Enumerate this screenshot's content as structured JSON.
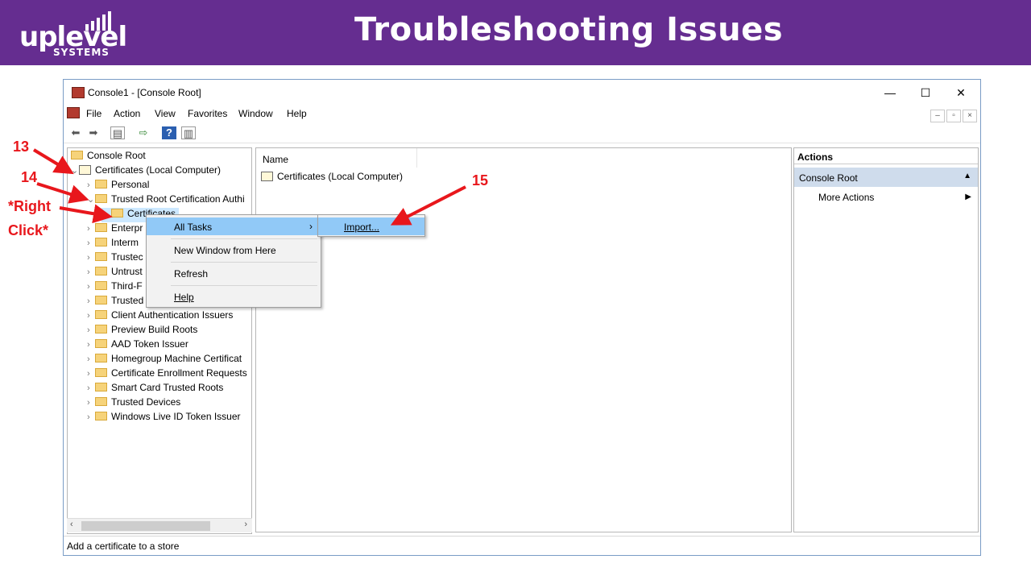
{
  "slide": {
    "logo_text": "uplevel",
    "logo_subtext": "SYSTEMS",
    "title": "Troubleshooting Issues"
  },
  "window": {
    "title": "Console1 - [Console Root]",
    "controls": {
      "minimize": "—",
      "maximize": "☐",
      "close": "✕"
    },
    "menu": [
      "File",
      "Action",
      "View",
      "Favorites",
      "Window",
      "Help"
    ]
  },
  "tree": {
    "items": [
      {
        "label": "Console Root"
      },
      {
        "label": "Certificates (Local Computer)"
      },
      {
        "label": "Personal"
      },
      {
        "label": "Trusted Root Certification Authi"
      },
      {
        "label": "Certificates"
      },
      {
        "label": "Enterpr"
      },
      {
        "label": "Interm"
      },
      {
        "label": "Trustec"
      },
      {
        "label": "Untrust"
      },
      {
        "label": "Third-F"
      },
      {
        "label": "Trusted"
      },
      {
        "label": "Client Authentication Issuers"
      },
      {
        "label": "Preview Build Roots"
      },
      {
        "label": "AAD Token Issuer"
      },
      {
        "label": "Homegroup Machine Certificat"
      },
      {
        "label": "Certificate Enrollment Requests"
      },
      {
        "label": "Smart Card Trusted Roots"
      },
      {
        "label": "Trusted Devices"
      },
      {
        "label": "Windows Live ID Token Issuer"
      }
    ]
  },
  "center": {
    "column_name": "Name",
    "rows": [
      "Certificates (Local Computer)"
    ]
  },
  "actions": {
    "header": "Actions",
    "selected": "Console Root",
    "more": "More Actions"
  },
  "status": "Add a certificate to a store",
  "context_menu": {
    "all_tasks": "All Tasks",
    "new_window": "New Window from Here",
    "refresh": "Refresh",
    "help": "Help"
  },
  "submenu": {
    "import": "Import..."
  },
  "annotations": {
    "step13": "13",
    "step14": "14",
    "step15": "15",
    "right_click_1": "*Right",
    "right_click_2": "Click*",
    "color": "#e8171c"
  },
  "colors": {
    "brand": "#652d90",
    "selection": "#cce8ff",
    "menu_highlight": "#91c9f7"
  }
}
